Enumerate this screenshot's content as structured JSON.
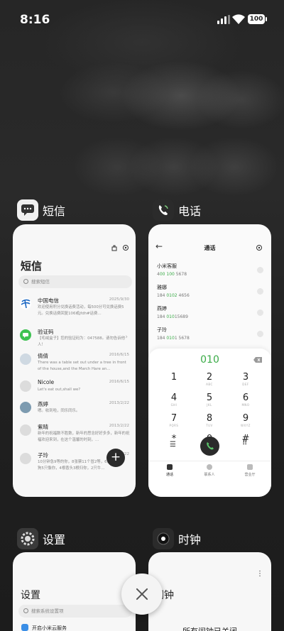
{
  "status_bar": {
    "time": "8:16",
    "battery": "100"
  },
  "sms_app": {
    "name": "短信",
    "title": "短信",
    "search_placeholder": "搜索短信",
    "messages": [
      {
        "name": "中国电信",
        "date": "2025/9/30",
        "preview": "欢迎使用积分兑换话费活动，每500分可兑换话费5元。兑换话费回复106或jfdh#话费…"
      },
      {
        "name": "验证码",
        "date": "",
        "preview": "【毛绒盒子】您的验证码为：047588。请勿告诉他人！"
      },
      {
        "name": "倩倩",
        "date": "2016/6/15",
        "preview": "There was a table set out under a tree in front of the house,and the March Hare an…"
      },
      {
        "name": "Nicole",
        "date": "2016/6/15",
        "preview": "Let's eat out,shall we?"
      },
      {
        "name": "燕婷",
        "date": "2013/2/22",
        "preview": "嗯。收到啦，同乐同乐。"
      },
      {
        "name": "紫晴",
        "date": "2013/2/22",
        "preview": "新年的祝福数不胜数，新年的思念好好多多，新年的祝福欢迎来到，在这个温馨的时刻，…"
      },
      {
        "name": "子玲",
        "date": "2013/2/22",
        "preview": "10分钟急9等的你，8张票11个冒2等，6只小狗5只像你，4根香头3根归你，2只牛…"
      }
    ]
  },
  "phone_app": {
    "name": "电话",
    "title": "通话",
    "contacts": [
      {
        "name": "小米客服",
        "num_pre": "4",
        "num_hl": "00 100",
        "num_post": " 5678"
      },
      {
        "name": "雅娜",
        "num_pre": "184 ",
        "num_hl": "0102",
        "num_post": " 4656"
      },
      {
        "name": "燕婷",
        "num_pre": "184 ",
        "num_hl": "010",
        "num_post": "15689"
      },
      {
        "name": "子玲",
        "num_pre": "184 ",
        "num_hl": "010",
        "num_post": "1 5678"
      }
    ],
    "dialed": "010",
    "keys": [
      {
        "d": "1",
        "l": ""
      },
      {
        "d": "2",
        "l": "ABC"
      },
      {
        "d": "3",
        "l": "DEF"
      },
      {
        "d": "4",
        "l": "GHI"
      },
      {
        "d": "5",
        "l": "JKL"
      },
      {
        "d": "6",
        "l": "MNO"
      },
      {
        "d": "7",
        "l": "PQRS"
      },
      {
        "d": "8",
        "l": "TUV"
      },
      {
        "d": "9",
        "l": "WXYZ"
      },
      {
        "d": "*",
        "l": ","
      },
      {
        "d": "0",
        "l": "+"
      },
      {
        "d": "#",
        "l": ""
      }
    ],
    "tabs": [
      "通话",
      "联系人",
      "营业厅"
    ]
  },
  "settings_app": {
    "name": "设置",
    "title": "设置",
    "search_placeholder": "搜索系统设置项",
    "first_item": "开启小米云服务"
  },
  "clock_app": {
    "name": "时钟",
    "title": "闹钟",
    "message": "所有闹钟已关闭"
  },
  "colors": {
    "accent_green": "#3aab47"
  }
}
